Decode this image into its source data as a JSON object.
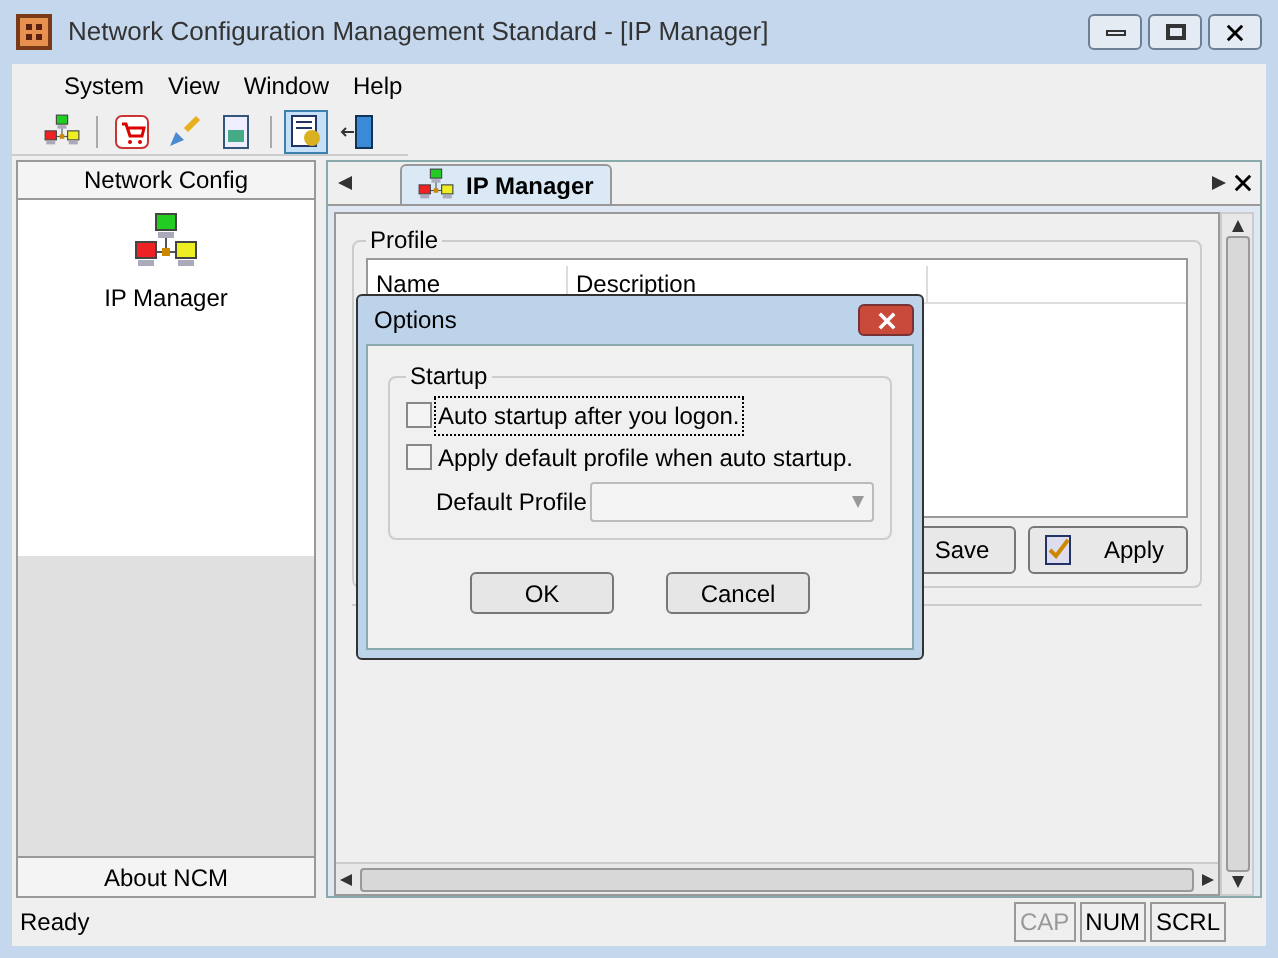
{
  "window": {
    "title": "Network Configuration Management Standard - [IP Manager]"
  },
  "menu": [
    {
      "label": "System"
    },
    {
      "label": "View"
    },
    {
      "label": "Window"
    },
    {
      "label": "Help"
    }
  ],
  "toolbar": [
    {
      "kind": "network",
      "pressed": false
    },
    {
      "kind": "separator"
    },
    {
      "kind": "cart",
      "pressed": false
    },
    {
      "kind": "brush",
      "pressed": false
    },
    {
      "kind": "document",
      "pressed": false
    },
    {
      "kind": "separator"
    },
    {
      "kind": "options",
      "pressed": true
    },
    {
      "kind": "exit",
      "pressed": false
    }
  ],
  "sidebar": {
    "header": "Network Config",
    "items": [
      {
        "label": "IP Manager"
      }
    ],
    "footer": "About NCM"
  },
  "tabs": [
    {
      "label": "IP Manager",
      "selected": true
    }
  ],
  "profile": {
    "title": "Profile",
    "columns": [
      "Name",
      "Description"
    ],
    "buttons": [
      {
        "label": "Save",
        "kind": "save"
      },
      {
        "label": "Apply",
        "kind": "apply"
      }
    ]
  },
  "dialog": {
    "title": "Options",
    "group": "Startup",
    "checks": [
      {
        "label": "Auto startup after you logon.",
        "checked": false,
        "focused": true
      },
      {
        "label": "Apply default profile when auto startup.",
        "checked": false,
        "focused": false
      }
    ],
    "field_label": "Default Profile",
    "buttons": [
      "OK",
      "Cancel"
    ]
  },
  "status_bar": {
    "text": "Ready",
    "indicators": [
      {
        "label": "CAP",
        "enabled": false
      },
      {
        "label": "NUM",
        "enabled": true
      },
      {
        "label": "SCRL",
        "enabled": true
      }
    ]
  }
}
